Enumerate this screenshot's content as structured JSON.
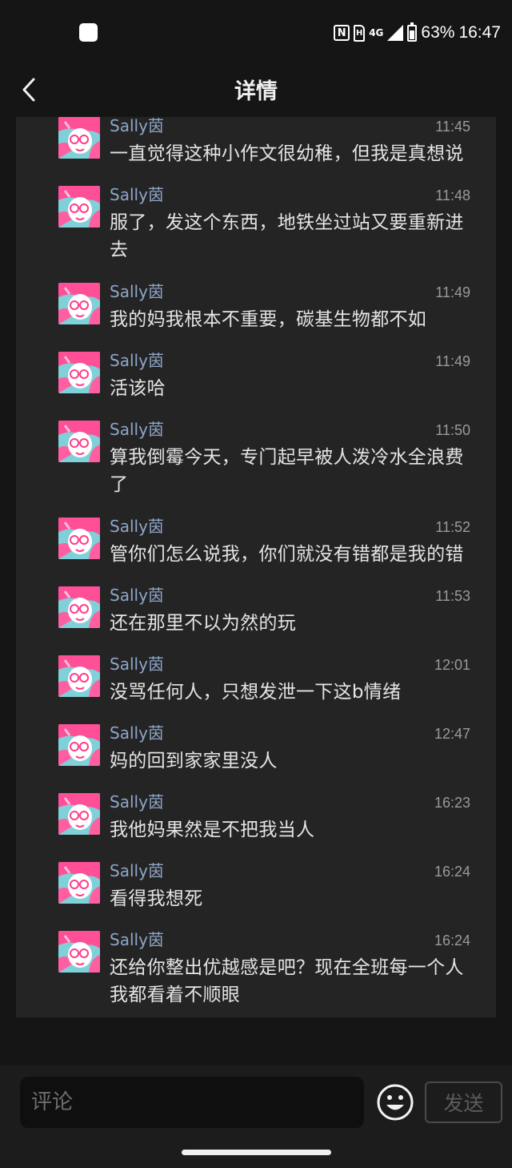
{
  "status_bar": {
    "nfc_label": "N",
    "sim_label": "H",
    "network_label": "4G",
    "battery": "63%",
    "time": "16:47"
  },
  "header": {
    "title": "详情",
    "back_icon": "chevron-left-icon"
  },
  "messages": [
    {
      "user": "Sally茵",
      "time": "11:45",
      "text": "一直觉得这种小作文很幼稚，但我是真想说"
    },
    {
      "user": "Sally茵",
      "time": "11:48",
      "text": "服了，发这个东西，地铁坐过站又要重新进去"
    },
    {
      "user": "Sally茵",
      "time": "11:49",
      "text": "我的妈我根本不重要，碳基生物都不如"
    },
    {
      "user": "Sally茵",
      "time": "11:49",
      "text": "活该哈"
    },
    {
      "user": "Sally茵",
      "time": "11:50",
      "text": "算我倒霉今天，专门起早被人泼冷水全浪费了"
    },
    {
      "user": "Sally茵",
      "time": "11:52",
      "text": "管你们怎么说我，你们就没有错都是我的错"
    },
    {
      "user": "Sally茵",
      "time": "11:53",
      "text": "还在那里不以为然的玩"
    },
    {
      "user": "Sally茵",
      "time": "12:01",
      "text": "没骂任何人，只想发泄一下这b情绪"
    },
    {
      "user": "Sally茵",
      "time": "12:47",
      "text": "妈的回到家家里没人"
    },
    {
      "user": "Sally茵",
      "time": "16:23",
      "text": "我他妈果然是不把我当人"
    },
    {
      "user": "Sally茵",
      "time": "16:24",
      "text": "看得我想死"
    },
    {
      "user": "Sally茵",
      "time": "16:24",
      "text": "还给你整出优越感是吧？现在全班每一个人我都看着不顺眼"
    }
  ],
  "composer": {
    "placeholder": "评论",
    "send_label": "发送",
    "emoji_icon": "smiley-icon"
  },
  "colors": {
    "background": "#151515",
    "panel": "#242424",
    "username": "#8ea6c8",
    "text": "#e4e4e4",
    "timestamp": "#9a9a9a"
  }
}
